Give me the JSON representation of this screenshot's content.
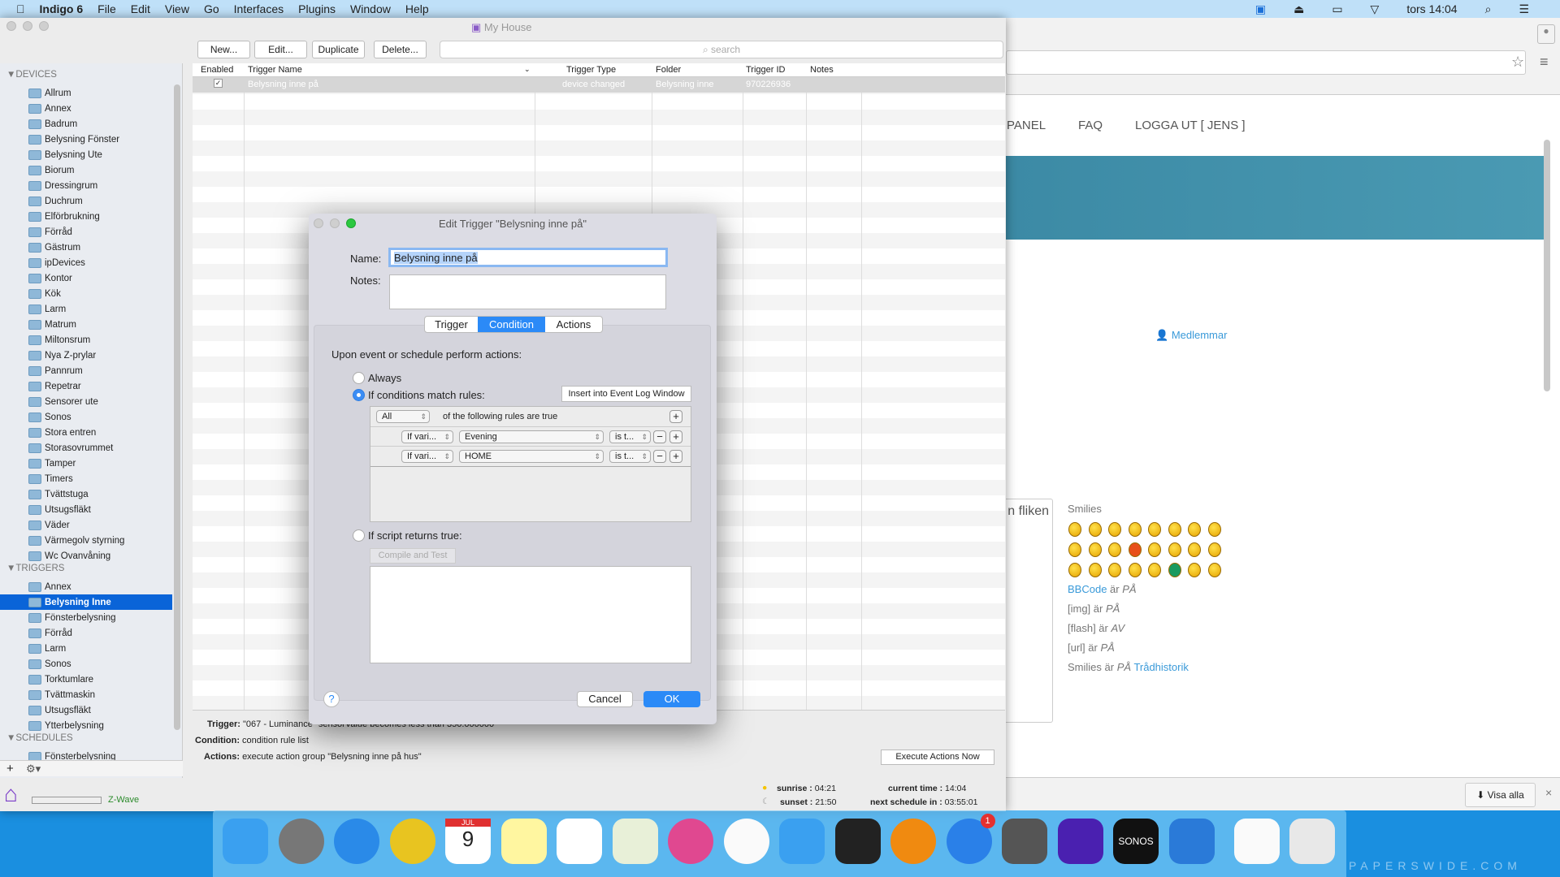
{
  "menubar": {
    "app": "Indigo 6",
    "items": [
      "File",
      "Edit",
      "View",
      "Go",
      "Interfaces",
      "Plugins",
      "Window",
      "Help"
    ],
    "clock": "tors 14:04"
  },
  "window": {
    "title": "My House"
  },
  "toolbar": {
    "new": "New...",
    "edit": "Edit...",
    "duplicate": "Duplicate",
    "delete": "Delete...",
    "search_placeholder": "search"
  },
  "sidebar": {
    "devices_header": "DEVICES",
    "devices": [
      "Allrum",
      "Annex",
      "Badrum",
      "Belysning Fönster",
      "Belysning Ute",
      "Biorum",
      "Dressingrum",
      "Duchrum",
      "Elförbrukning",
      "Förråd",
      "Gästrum",
      "ipDevices",
      "Kontor",
      "Kök",
      "Larm",
      "Matrum",
      "Miltonsrum",
      "Nya Z-prylar",
      "Pannrum",
      "Repetrar",
      "Sensorer ute",
      "Sonos",
      "Stora entren",
      "Storasovrummet",
      "Tamper",
      "Timers",
      "Tvättstuga",
      "Utsugsfläkt",
      "Väder",
      "Värmegolv styrning",
      "Wc Ovanvåning"
    ],
    "triggers_header": "TRIGGERS",
    "triggers": [
      "Annex",
      "Belysning Inne",
      "Fönsterbelysning",
      "Förråd",
      "Larm",
      "Sonos",
      "Torktumlare",
      "Tvättmaskin",
      "Utsugsfläkt",
      "Ytterbelysning"
    ],
    "selected_trigger": "Belysning Inne",
    "schedules_header": "SCHEDULES",
    "schedules": [
      "Fönsterbelysning"
    ],
    "add": "+",
    "gear": "⚙▾",
    "interface": "Z-Wave"
  },
  "table": {
    "columns": [
      "Enabled",
      "Trigger Name",
      "Trigger Type",
      "Folder",
      "Trigger ID",
      "Notes"
    ],
    "rows": [
      {
        "enabled": true,
        "name": "Belysning inne på",
        "type": "device changed",
        "folder": "Belysning inne",
        "id": "970226936",
        "notes": ""
      }
    ]
  },
  "details": {
    "trigger_label": "Trigger:",
    "trigger": "\"067 - Luminance\" sensorValue becomes less than 350.000000",
    "condition_label": "Condition:",
    "condition": "condition rule list",
    "actions_label": "Actions:",
    "actions": "execute action group \"Belysning inne på hus\"",
    "execute": "Execute Actions Now"
  },
  "status": {
    "sunrise_label": "sunrise :",
    "sunrise": "04:21",
    "sunset_label": "sunset :",
    "sunset": "21:50",
    "current_label": "current time :",
    "current": "14:04",
    "next_label": "next schedule in :",
    "next": "03:55:01"
  },
  "dialog": {
    "title": "Edit Trigger \"Belysning inne på\"",
    "name_label": "Name:",
    "name_value": "Belysning inne på",
    "notes_label": "Notes:",
    "notes_value": "",
    "tabs": [
      "Trigger",
      "Condition",
      "Actions"
    ],
    "active_tab": "Condition",
    "heading": "Upon event or schedule perform actions:",
    "always": "Always",
    "if_conditions": "If conditions match rules:",
    "insert": "Insert into Event Log Window",
    "match_mode": "All",
    "match_text": "of the following rules are true",
    "rules": [
      {
        "type": "If vari...",
        "variable": "Evening",
        "op": "is t..."
      },
      {
        "type": "If vari...",
        "variable": "HOME",
        "op": "is t..."
      }
    ],
    "script": "If script returns true:",
    "compile": "Compile and Test",
    "script_value": "",
    "selected_option": "If conditions match rules:",
    "help": "?",
    "cancel": "Cancel",
    "ok": "OK"
  },
  "browser": {
    "nav": [
      "PANEL",
      "FAQ",
      "LOGGA UT [ JENS ]"
    ],
    "members": "Medlemmar",
    "textarea_text": "n fliken",
    "smilies": "Smilies",
    "bbcode_link": "BBCode",
    "bbcode_rest": "är",
    "on": "PÅ",
    "off": "AV",
    "img": "[img] är",
    "flash": "[flash] är",
    "url": "[url] är",
    "smilies_status": "Smilies är",
    "history": "Trådhistorik",
    "download_button": "Visa alla",
    "close": "×",
    "accent": "#3a9ad9"
  },
  "dock": {
    "apps": [
      "Finder",
      "Launchpad",
      "Safari",
      "Chrome",
      "Calendar",
      "Notes",
      "Reminders",
      "Maps",
      "iTunes",
      "Photos",
      "Messages",
      "iMovie",
      "iBooks",
      "App Store",
      "System Preferences",
      "Indigo",
      "Sonos",
      "TeamViewer",
      "Documents",
      "Trash"
    ],
    "calendar_month": "JUL",
    "calendar_day": "9",
    "appstore_badge": "1",
    "sonos_label": "SONOS"
  },
  "wallpaper_text": "PAPERSWIDE.COM"
}
